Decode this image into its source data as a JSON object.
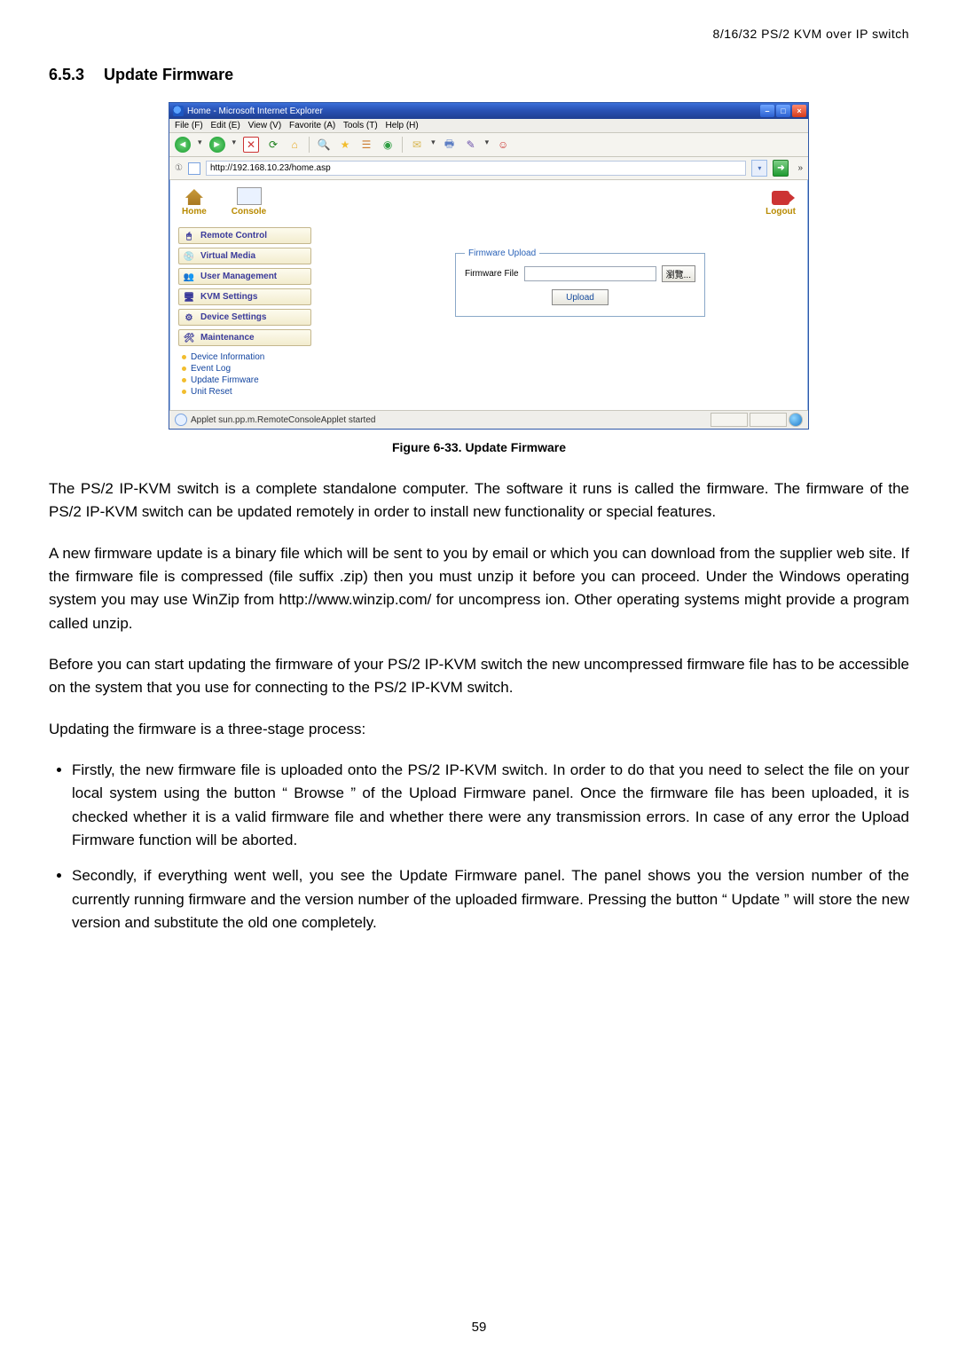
{
  "header": "8/16/32 PS/2 KVM over IP switch",
  "sect_num": "6.5.3",
  "sect_title": "Update Firmware",
  "ie": {
    "title": "Home - Microsoft Internet Explorer",
    "menu": {
      "file": "File (F)",
      "edit": "Edit (E)",
      "view": "View (V)",
      "favorite": "Favorite (A)",
      "tools": "Tools (T)",
      "help": "Help (H)"
    },
    "addr_label": "①",
    "addr_url": "http://192.168.10.23/home.asp",
    "links_chev": "»",
    "topstrip": {
      "home": "Home",
      "console": "Console",
      "logout": "Logout"
    },
    "nav": {
      "remote": "Remote Control",
      "virtual": "Virtual Media",
      "user": "User Management",
      "kvm": "KVM Settings",
      "device": "Device Settings",
      "maint": "Maintenance",
      "sub": {
        "devinfo": "Device Information",
        "eventlog": "Event Log",
        "updatefw": "Update Firmware",
        "unitreset": "Unit Reset"
      }
    },
    "panel": {
      "legend": "Firmware Upload",
      "file_label": "Firmware File",
      "browse": "瀏覽...",
      "upload": "Upload"
    },
    "status": "Applet sun.pp.m.RemoteConsoleApplet started"
  },
  "fig_caption": "Figure 6-33. Update Firmware",
  "para1": "The PS/2 IP-KVM switch is a complete standalone computer. The software it runs is called the firmware. The firmware of the PS/2 IP-KVM switch can be updated remotely in order to install new functionality or special features.",
  "para2": "A new firmware update is a binary file which will be sent to you by email or which you can download from the supplier web site. If the firmware file is compressed (file suffix .zip) then you must unzip it before you can proceed. Under the Windows operating system you may use WinZip from http://www.winzip.com/ for uncompress ion. Other operating systems might provide a program called unzip.",
  "para3": "Before you can start updating the firmware of your PS/2 IP-KVM switch the new uncompressed firmware file has to be accessible on the system that you use for connecting to the PS/2 IP-KVM switch.",
  "para4": "Updating the firmware is a three-stage process:",
  "bullet1": "Firstly, the new firmware file is uploaded onto the PS/2 IP-KVM switch. In order to do that you need to select the file on your local system using the button “ Browse ” of the Upload Firmware panel. Once the firmware file has been uploaded, it is checked whether it is a valid firmware file and whether there were any transmission errors. In case of any error the Upload Firmware function will be aborted.",
  "bullet2": "Secondly, if everything went well, you see the Update Firmware panel. The panel shows you the version number of the currently running firmware and the version number of the uploaded firmware. Pressing the button “ Update ” will store the new version and substitute the old one completely.",
  "page_num": "59"
}
